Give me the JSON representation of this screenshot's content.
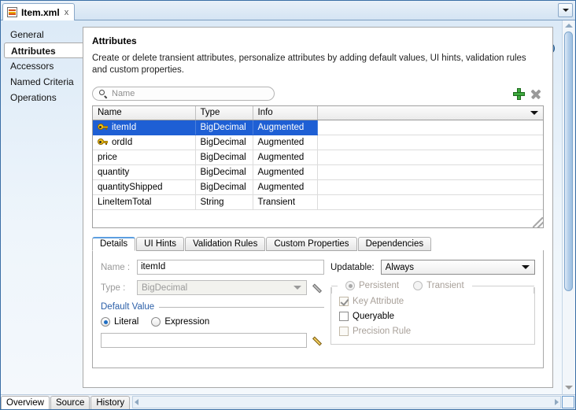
{
  "window": {
    "document_tab": {
      "label": "Item.xml",
      "close_label": "x",
      "icon": "xml-file-icon"
    },
    "tab_menu_icon": "chevron-down-icon",
    "help_icon": "help-question-icon",
    "help_label": "?"
  },
  "sidebar": {
    "items": [
      {
        "label": "General",
        "selected": false
      },
      {
        "label": "Attributes",
        "selected": true
      },
      {
        "label": "Accessors",
        "selected": false
      },
      {
        "label": "Named Criteria",
        "selected": false
      },
      {
        "label": "Operations",
        "selected": false
      }
    ]
  },
  "main": {
    "title": "Attributes",
    "description": "Create or delete transient attributes, personalize attributes by adding default values, UI hints, validation rules and custom properties.",
    "search": {
      "placeholder": "Name",
      "value": "",
      "icon": "search-icon"
    },
    "toolbar": {
      "add_icon": "plus-icon",
      "add_title": "Add",
      "delete_icon": "close-x-icon",
      "delete_title": "Delete"
    },
    "table": {
      "columns": [
        "Name",
        "Type",
        "Info"
      ],
      "header_menu_icon": "chevron-down-icon",
      "rows": [
        {
          "name": "itemId",
          "type": "BigDecimal",
          "info": "Augmented",
          "key": true,
          "selected": true
        },
        {
          "name": "ordId",
          "type": "BigDecimal",
          "info": "Augmented",
          "key": true,
          "selected": false
        },
        {
          "name": "price",
          "type": "BigDecimal",
          "info": "Augmented",
          "key": false,
          "selected": false
        },
        {
          "name": "quantity",
          "type": "BigDecimal",
          "info": "Augmented",
          "key": false,
          "selected": false
        },
        {
          "name": "quantityShipped",
          "type": "BigDecimal",
          "info": "Augmented",
          "key": false,
          "selected": false
        },
        {
          "name": "LineItemTotal",
          "type": "String",
          "info": "Transient",
          "key": false,
          "selected": false
        }
      ]
    },
    "detail_tabs": [
      {
        "label": "Details",
        "active": true
      },
      {
        "label": "UI Hints",
        "active": false
      },
      {
        "label": "Validation Rules",
        "active": false
      },
      {
        "label": "Custom Properties",
        "active": false
      },
      {
        "label": "Dependencies",
        "active": false
      }
    ],
    "details": {
      "name_label": "Name :",
      "name_value": "itemId",
      "type_label": "Type :",
      "type_value": "BigDecimal",
      "type_edit_icon": "pencil-icon",
      "default_value_group": "Default Value",
      "literal_label": "Literal",
      "expression_label": "Expression",
      "default_value_input": "",
      "default_value_edit_icon": "pencil-icon",
      "updatable_label": "Updatable:",
      "updatable_value": "Always",
      "persistent_label": "Persistent",
      "transient_label": "Transient",
      "key_attribute_label": "Key Attribute",
      "queryable_label": "Queryable",
      "precision_rule_label": "Precision Rule"
    }
  },
  "bottom": {
    "tabs": [
      {
        "label": "Overview",
        "active": true
      },
      {
        "label": "Source",
        "active": false
      },
      {
        "label": "History",
        "active": false
      }
    ],
    "scroll_left_icon": "arrow-left-icon",
    "scroll_right_icon": "arrow-right-icon"
  },
  "colors": {
    "selection": "#1e5fd4",
    "group_title": "#2b5fa8",
    "add_green": "#3fa93f",
    "key_yellow": "#f5c518"
  }
}
